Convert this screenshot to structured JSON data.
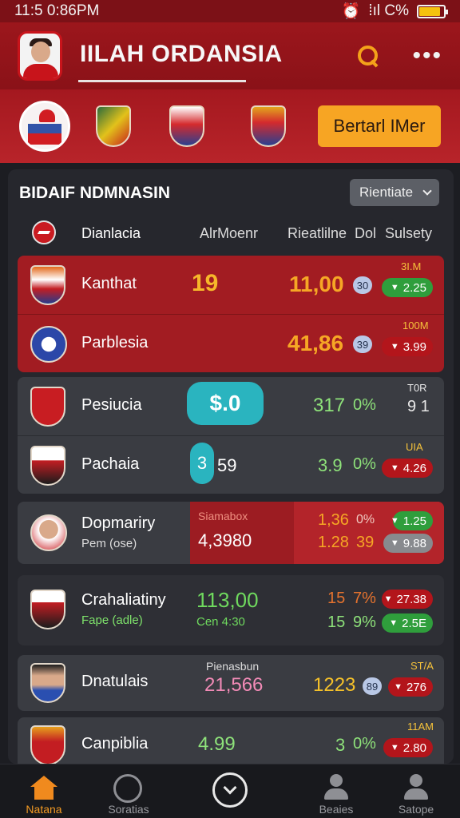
{
  "status_bar": {
    "time": "11:5 0:86PM",
    "right_text": "⁞ıl C%"
  },
  "header": {
    "title": "IILAH ORDANSIA"
  },
  "logos_row": {
    "cta_label": "Bertarl IMer"
  },
  "panel": {
    "title": "BIDAIF NDMNASIN",
    "filter_label": "Rientiate",
    "columns": {
      "team": "Dianlacia",
      "col2": "AlrMoenr",
      "col3": "Rieatlilne",
      "col4": "Dol",
      "col5": "Sulsety"
    }
  },
  "rows": [
    {
      "name": "Kanthat",
      "c2": "19",
      "c3": "11,00",
      "pill": "30",
      "badge_top": "3I.M",
      "badge": "2.25",
      "badge_color": "green"
    },
    {
      "name": "Parblesia",
      "c3": "41,86",
      "pill": "39",
      "badge_top": "100M",
      "badge": "3.99",
      "badge_color": "red"
    },
    {
      "name": "Pesiucia",
      "c2": "$.0",
      "c3": "317",
      "pct": "0%",
      "badge_top": "T0R",
      "badge": "9 1"
    },
    {
      "name": "Pachaia",
      "c2a": "3",
      "c2b": "59",
      "c3": "3.9",
      "pct": "0%",
      "badge_top": "UIA",
      "badge": "4.26",
      "badge_color": "red"
    },
    {
      "name": "Dopmariry",
      "sub": "Pem (ose)",
      "c2_label": "Siamabox",
      "c2": "4,3980",
      "c3a": "1,36",
      "c3b": "1.28",
      "pa": "0%",
      "pb": "39",
      "badge_a": "1.25",
      "badge_b": "9.88",
      "badge_a_color": "green",
      "badge_b_color": "gray"
    },
    {
      "name": "Crahaliatiny",
      "sub": "Fape (adle)",
      "c2": "113,00",
      "c2_sub": "Cen 4:30",
      "c3a": "15",
      "c3b": "15",
      "pa": "7%",
      "pb": "9%",
      "badge_a": "27.38",
      "badge_b": "2.5E",
      "badge_a_color": "red",
      "badge_b_color": "green"
    },
    {
      "name": "Dnatulais",
      "c2_label": "Pienasbun",
      "c2": "21,566",
      "c3": "1223",
      "pill": "89",
      "badge_top": "ST/A",
      "badge": "276",
      "badge_color": "red"
    },
    {
      "name": "Canpiblia",
      "c2": "4.99",
      "c3": "3",
      "pct": "0%",
      "badge_top": "11AM",
      "badge": "2.80",
      "badge_color": "red"
    }
  ],
  "bottom_nav": [
    {
      "label": "Natana",
      "active": true
    },
    {
      "label": "Soratias",
      "active": false
    },
    {
      "label": "Beaies",
      "active": false
    },
    {
      "label": "Satope",
      "active": false
    }
  ]
}
